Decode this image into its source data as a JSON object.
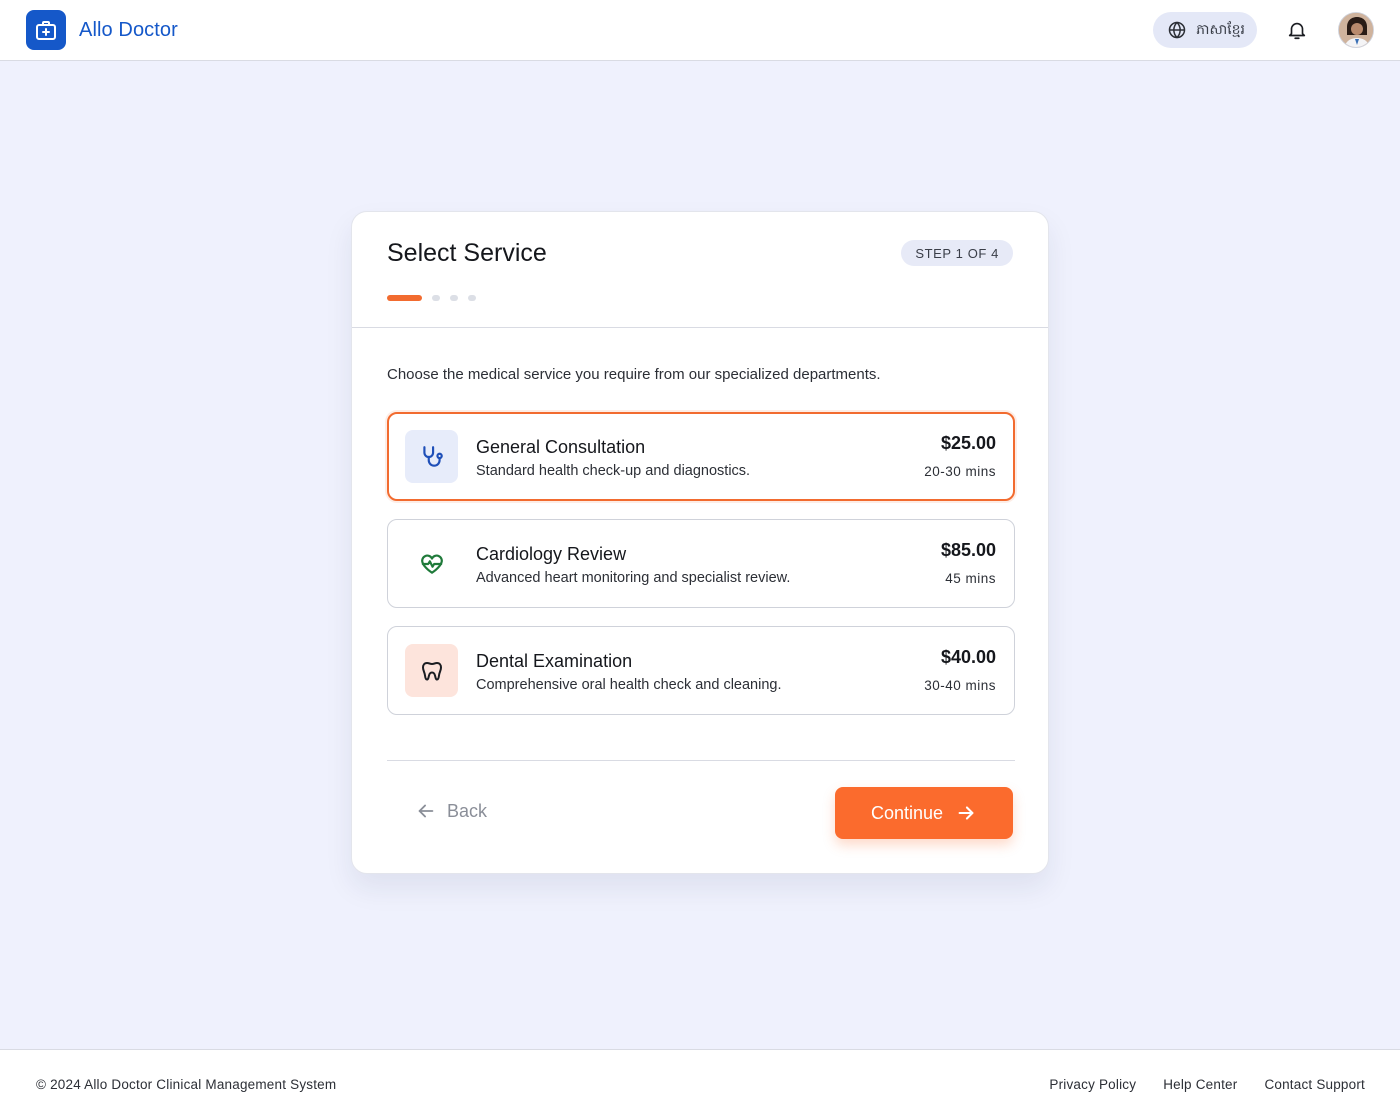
{
  "app": {
    "name": "Allo Doctor",
    "brand_color": "#1558c9",
    "accent_color": "#fb6b2d"
  },
  "header": {
    "language_label": "ភាសាខ្មែរ",
    "language_icon": "globe-icon",
    "notification_icon": "bell-icon"
  },
  "wizard": {
    "title": "Select Service",
    "step_label": "STEP 1 OF 4",
    "current_step": 1,
    "total_steps": 4,
    "intro": "Choose the medical service you require from our specialized departments.",
    "services": [
      {
        "name": "General Consultation",
        "description": "Standard health check-up and diagnostics.",
        "price": "$25.00",
        "duration": "20-30 mins",
        "icon": "stethoscope-icon",
        "selected": true
      },
      {
        "name": "Cardiology Review",
        "description": "Advanced heart monitoring and specialist review.",
        "price": "$85.00",
        "duration": "45 mins",
        "icon": "heart-pulse-icon",
        "selected": false
      },
      {
        "name": "Dental Examination",
        "description": "Comprehensive oral health check and cleaning.",
        "price": "$40.00",
        "duration": "30-40 mins",
        "icon": "tooth-icon",
        "selected": false
      }
    ],
    "back_label": "Back",
    "continue_label": "Continue"
  },
  "footer": {
    "copyright": "© 2024 Allo Doctor Clinical Management System",
    "links": [
      "Privacy Policy",
      "Help Center",
      "Contact Support"
    ]
  }
}
